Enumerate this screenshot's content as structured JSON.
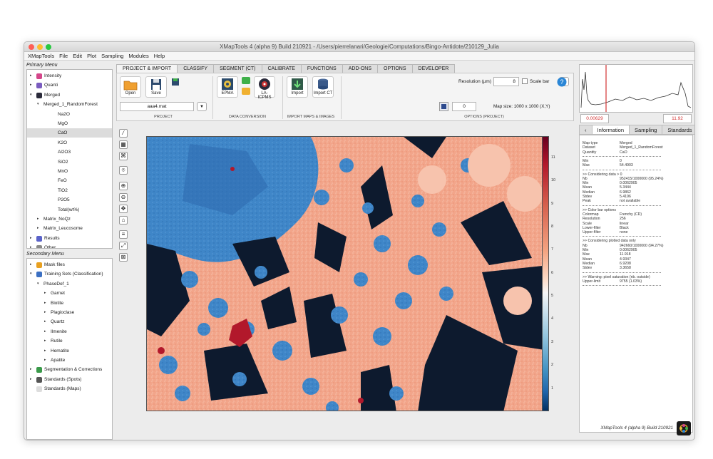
{
  "window": {
    "title": "XMapTools 4 (alpha 9) Build 210921 - /Users/pierrelanari/Geologie/Computations/Bingo-Antidote/210129_Julia"
  },
  "menubar": [
    "XMapTools",
    "File",
    "Edit",
    "Plot",
    "Sampling",
    "Modules",
    "Help"
  ],
  "primary_menu": {
    "title": "Primary Menu",
    "items": [
      {
        "label": "Intensity",
        "arrow": "▸",
        "icon": "flower-icon",
        "indent": 1,
        "color": "#d4468a"
      },
      {
        "label": "Quanti",
        "arrow": "▸",
        "icon": "cube-icon",
        "indent": 1,
        "color": "#7a5cbf"
      },
      {
        "label": "Merged",
        "arrow": "▾",
        "icon": "map-stack-icon",
        "indent": 1,
        "color": "#2a2a3a"
      },
      {
        "label": "Merged_1_RandomForest",
        "arrow": "▾",
        "icon": "",
        "indent": 2,
        "color": ""
      },
      {
        "label": "Na2O",
        "arrow": "",
        "icon": "",
        "indent": 4,
        "color": ""
      },
      {
        "label": "MgO",
        "arrow": "",
        "icon": "",
        "indent": 4,
        "color": ""
      },
      {
        "label": "CaO",
        "arrow": "",
        "icon": "",
        "indent": 4,
        "color": "",
        "selected": true
      },
      {
        "label": "K2O",
        "arrow": "",
        "icon": "",
        "indent": 4,
        "color": ""
      },
      {
        "label": "Al2O3",
        "arrow": "",
        "icon": "",
        "indent": 4,
        "color": ""
      },
      {
        "label": "SiO2",
        "arrow": "",
        "icon": "",
        "indent": 4,
        "color": ""
      },
      {
        "label": "MnO",
        "arrow": "",
        "icon": "",
        "indent": 4,
        "color": ""
      },
      {
        "label": "FeO",
        "arrow": "",
        "icon": "",
        "indent": 4,
        "color": ""
      },
      {
        "label": "TiO2",
        "arrow": "",
        "icon": "",
        "indent": 4,
        "color": ""
      },
      {
        "label": "P2O5",
        "arrow": "",
        "icon": "",
        "indent": 4,
        "color": ""
      },
      {
        "label": "Total(wt%)",
        "arrow": "",
        "icon": "",
        "indent": 4,
        "color": ""
      },
      {
        "label": "Matrix_NoQz",
        "arrow": "▸",
        "icon": "",
        "indent": 2,
        "color": ""
      },
      {
        "label": "Matrix_Leucosome",
        "arrow": "▸",
        "icon": "",
        "indent": 2,
        "color": ""
      },
      {
        "label": "Results",
        "arrow": "▸",
        "icon": "results-icon",
        "indent": 1,
        "color": "#5a63c9"
      },
      {
        "label": "Other",
        "arrow": "▸",
        "icon": "other-icon",
        "indent": 1,
        "color": "#888888"
      }
    ]
  },
  "secondary_menu": {
    "title": "Secondary Menu",
    "items": [
      {
        "label": "Mask files",
        "arrow": "▸",
        "icon": "mask-icon",
        "indent": 1,
        "color": "#e8a020"
      },
      {
        "label": "Training Sets (Classification)",
        "arrow": "▾",
        "icon": "training-icon",
        "indent": 1,
        "color": "#3b6fc2"
      },
      {
        "label": "PhaseDef_1",
        "arrow": "▾",
        "icon": "",
        "indent": 2,
        "color": ""
      },
      {
        "label": "Garnet",
        "arrow": "▸",
        "icon": "",
        "indent": 3,
        "color": ""
      },
      {
        "label": "Biotite",
        "arrow": "▸",
        "icon": "",
        "indent": 3,
        "color": ""
      },
      {
        "label": "Plagioclase",
        "arrow": "▸",
        "icon": "",
        "indent": 3,
        "color": ""
      },
      {
        "label": "Quartz",
        "arrow": "▸",
        "icon": "",
        "indent": 3,
        "color": ""
      },
      {
        "label": "Ilmenite",
        "arrow": "▸",
        "icon": "",
        "indent": 3,
        "color": ""
      },
      {
        "label": "Rutile",
        "arrow": "▸",
        "icon": "",
        "indent": 3,
        "color": ""
      },
      {
        "label": "Hematite",
        "arrow": "▸",
        "icon": "",
        "indent": 3,
        "color": ""
      },
      {
        "label": "Apatite",
        "arrow": "▸",
        "icon": "",
        "indent": 3,
        "color": ""
      },
      {
        "label": "Segmentation & Corrections",
        "arrow": "▸",
        "icon": "segmentation-icon",
        "indent": 1,
        "color": "#3a9a4a"
      },
      {
        "label": "Standards (Spots)",
        "arrow": "▸",
        "icon": "standards-spots-icon",
        "indent": 1,
        "color": "#555555"
      },
      {
        "label": "Standards (Maps)",
        "arrow": "",
        "icon": "standards-maps-icon",
        "indent": 1,
        "color": "#dddddd"
      }
    ]
  },
  "tabs": [
    "PROJECT & IMPORT",
    "CLASSIFY",
    "SEGMENT (CT)",
    "CALIBRATE",
    "FUNCTIONS",
    "ADD-ONS",
    "OPTIONS",
    "DEVELOPER"
  ],
  "ribbon": {
    "project": {
      "open": "Open",
      "save": "Save",
      "file": "aaa4.mat",
      "group": "PROJECT"
    },
    "conversion": {
      "epma": "EPMA",
      "laicpms": "LA-ICPMS",
      "group": "DATA CONVERSION"
    },
    "import": {
      "import": "Import",
      "import_ct": "Import CT",
      "group": "IMPORT MAPS & IMAGES"
    },
    "options": {
      "resolution_label": "Resolution (µm)",
      "resolution_value": "8",
      "scale_bar_label": "Scale bar",
      "field_value": "0",
      "map_size": "Map size: 1000 x 1000 (X,Y)",
      "group": "OPTIONS (PROJECT)"
    }
  },
  "histogram": {
    "min_value": "0.00629",
    "max_value": "11.92"
  },
  "colorbar_ticks": [
    "11",
    "10",
    "9",
    "8",
    "7",
    "6",
    "5",
    "4",
    "3",
    "2",
    "1"
  ],
  "right_tabs": [
    "Information",
    "Sampling",
    "Standards"
  ],
  "info_lines": [
    {
      "k": "Map type",
      "v": "Merged"
    },
    {
      "k": "Dataset",
      "v": "Merged_1_RandomForest"
    },
    {
      "k": "Quantity",
      "v": "CaO"
    },
    {
      "k": "---",
      "v": ""
    },
    {
      "k": "Min",
      "v": "0"
    },
    {
      "k": "Max",
      "v": "54.4903"
    },
    {
      "k": "---",
      "v": ""
    },
    {
      "k": ">> Considering data > 0",
      "v": ""
    },
    {
      "k": "Nb",
      "v": "952415/1000000 (95.24%)"
    },
    {
      "k": "Min",
      "v": "0.0062905"
    },
    {
      "k": "Mean",
      "v": "5.3444"
    },
    {
      "k": "Median",
      "v": "6.9862"
    },
    {
      "k": "Stdev",
      "v": "5.4196"
    },
    {
      "k": "Peak",
      "v": "not available"
    },
    {
      "k": "---",
      "v": ""
    },
    {
      "k": ">> Color bar options",
      "v": ""
    },
    {
      "k": "Colormap",
      "v": "Frenchy (CD)"
    },
    {
      "k": "Resolution",
      "v": "256"
    },
    {
      "k": "Scale",
      "v": "linear"
    },
    {
      "k": "Lower-filter",
      "v": "Black"
    },
    {
      "k": "Upper-filter",
      "v": "none"
    },
    {
      "k": "---",
      "v": ""
    },
    {
      "k": ">> Considering plotted data only",
      "v": ""
    },
    {
      "k": "Nb",
      "v": "942660/1000000 (94.27%)"
    },
    {
      "k": "Min",
      "v": "0.0062905"
    },
    {
      "k": "Max",
      "v": "11.918"
    },
    {
      "k": "Mean",
      "v": "4.9347"
    },
    {
      "k": "Median",
      "v": "6.9208"
    },
    {
      "k": "Stdev",
      "v": "3.3658"
    },
    {
      "k": "---",
      "v": ""
    },
    {
      "k": ">> Warning: pixel saturation (nb. outside)",
      "v": ""
    },
    {
      "k": "Upper-limit",
      "v": "9755 (1.03%)"
    },
    {
      "k": "---",
      "v": ""
    }
  ],
  "footer": {
    "build": "XMapTools 4 (alpha 9) Build 210921"
  },
  "colors": {
    "accent": "#d33333",
    "blue_phase": "#3b7fc4",
    "orange_phase": "#f3a285"
  }
}
